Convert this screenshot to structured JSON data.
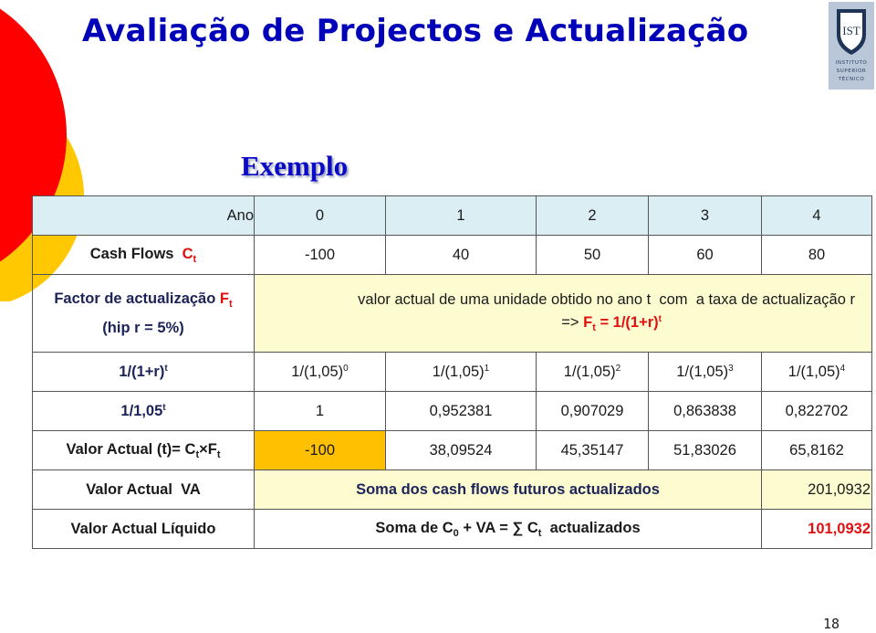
{
  "slide": {
    "title": "Avaliação de Projectos e Actualização",
    "subtitle": "Exemplo",
    "page_number": "18",
    "logo": {
      "icon": "ist-shield-logo",
      "monogram": "IST",
      "lines": [
        "INSTITUTO",
        "SUPERIOR",
        "TÉCNICO"
      ]
    },
    "colors": {
      "title": "#0000b8",
      "accent_red": "#e01010",
      "header_fill": "#dbeef4",
      "note_fill": "#fdfcd1",
      "highlight_fill": "#fec000",
      "deco_red": "#ff0000",
      "deco_yellow": "#ffc800"
    }
  },
  "table": {
    "year_row": {
      "label": "Ano",
      "values": [
        "0",
        "1",
        "2",
        "3",
        "4"
      ]
    },
    "cash_flows": {
      "label": "Cash Flows",
      "symbol": "C",
      "sub": "t",
      "values": [
        "-100",
        "40",
        "50",
        "60",
        "80"
      ]
    },
    "factor": {
      "label": "Factor de actualização",
      "symbol": "F",
      "sub": "t",
      "hypothesis": "(hip r = 5%)",
      "description": "valor actual de uma unidade obtido no ano t  com  a taxa de actualização r",
      "formula_prefix": "=>",
      "formula_symbol": "F",
      "formula_sub": "t",
      "formula_body": " = 1/(1+r)",
      "formula_sup": "t"
    },
    "formula_row": {
      "label": "1/(1+r)",
      "label_sup": "t",
      "cells": [
        {
          "base": "1/(1,05)",
          "exp": "0"
        },
        {
          "base": "1/(1,05)",
          "exp": "1"
        },
        {
          "base": "1/(1,05)",
          "exp": "2"
        },
        {
          "base": "1/(1,05)",
          "exp": "3"
        },
        {
          "base": "1/(1,05)",
          "exp": "4"
        }
      ]
    },
    "factor_values": {
      "label": "1/1,05",
      "label_sup": "t",
      "values": [
        "1",
        "0,952381",
        "0,907029",
        "0,863838",
        "0,822702"
      ]
    },
    "present_value": {
      "label": "Valor Actual (t)= C",
      "label_sub1": "t",
      "label_mid": "×F",
      "label_sub2": "t",
      "values": [
        "-100",
        "38,09524",
        "45,35147",
        "51,83026",
        "65,8162"
      ]
    },
    "va": {
      "label": "Valor Actual  VA",
      "description": "Soma dos cash flows futuros actualizados",
      "value": "201,0932"
    },
    "val": {
      "label": "Valor Actual Líquido",
      "desc_a": "Soma de C",
      "desc_sub0": "0",
      "desc_b": " + VA = ∑ C",
      "desc_subt": "t",
      "desc_c": "  actualizados",
      "value": "101,0932"
    }
  }
}
